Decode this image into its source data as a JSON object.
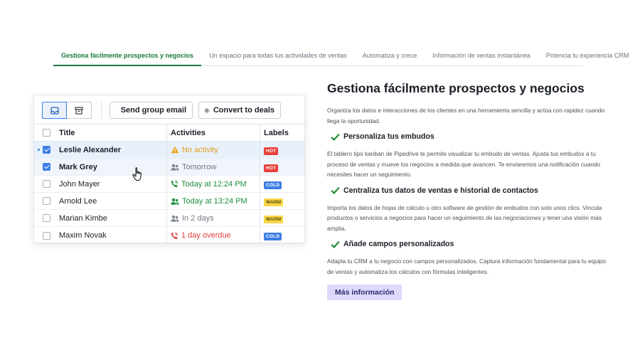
{
  "tabs": [
    {
      "label": "Gestiona fácilmente prospectos y negocios",
      "active": true
    },
    {
      "label": "Un espacio para todas tus actividades de ventas",
      "active": false
    },
    {
      "label": "Automatiza y crece",
      "active": false
    },
    {
      "label": "Información de ventas instantánea",
      "active": false
    },
    {
      "label": "Potencia tu experiencia CRM",
      "active": false
    }
  ],
  "toolbar": {
    "send_email_label": "Send group email",
    "convert_label": "Convert to deals"
  },
  "table": {
    "headers": {
      "title": "Title",
      "activities": "Activities",
      "labels": "Labels"
    },
    "rows": [
      {
        "name": "Leslie Alexander",
        "activity": "No activity",
        "activity_icon": "warning-icon",
        "activity_color": "#e2981a",
        "label": "HOT",
        "label_bg": "#e8403b",
        "label_fg": "#ffffff",
        "checked": true
      },
      {
        "name": "Mark Grey",
        "activity": "Tomorrow",
        "activity_icon": "people-icon",
        "activity_color": "#6f7680",
        "label": "HOT",
        "label_bg": "#e8403b",
        "label_fg": "#ffffff",
        "checked": true
      },
      {
        "name": "John Mayer",
        "activity": "Today at 12:24 PM",
        "activity_icon": "phone-icon",
        "activity_color": "#1e8f3c",
        "label": "COLD",
        "label_bg": "#3d7de5",
        "label_fg": "#ffffff",
        "checked": false
      },
      {
        "name": "Arnold Lee",
        "activity": "Today at 13:24 PM",
        "activity_icon": "people-icon",
        "activity_color": "#1e8f3c",
        "label": "WARM",
        "label_bg": "#f7d64a",
        "label_fg": "#5a4a00",
        "checked": false
      },
      {
        "name": "Marian Kimbe",
        "activity": "In 2 days",
        "activity_icon": "people-icon",
        "activity_color": "#6f7680",
        "label": "WARM",
        "label_bg": "#f7d64a",
        "label_fg": "#5a4a00",
        "checked": false
      },
      {
        "name": "Maxim Novak",
        "activity": "1 day overdue",
        "activity_icon": "phone-icon",
        "activity_color": "#e33b3b",
        "label": "COLD",
        "label_bg": "#3d7de5",
        "label_fg": "#ffffff",
        "checked": false
      }
    ]
  },
  "content": {
    "title": "Gestiona fácilmente prospectos y negocios",
    "intro": "Organiza los datos e interacciones de los clientes en una herramienta sencilla y actúa con rapidez cuando llega la oportunidad.",
    "features": [
      {
        "heading": "Personaliza tus embudos",
        "text": "El tablero tipo kanban de Pipedrive te permite visualizar tu embudo de ventas. Ajusta tus embudos a tu proceso de ventas y mueve los negocios a medida que avancen. Te enviaremos una notificación cuando necesites hacer un seguimiento."
      },
      {
        "heading": "Centraliza tus datos de ventas e historial de contactos",
        "text": "Importa los datos de hojas de cálculo u otro software de gestión de embudos con solo unos clics. Vincula productos o servicios a negocios para hacer un seguimiento de las negociaciones y tener una visión más amplia."
      },
      {
        "heading": "Añade campos personalizados",
        "text": "Adapta tu CRM a tu negocio con campos personalizados. Captura información fundamental para tu equipo de ventas y automatiza los cálculos con fórmulas inteligentes."
      }
    ],
    "cta_label": "Más información"
  },
  "colors": {
    "accent_green": "#187a3c",
    "check_green": "#1e8f3c",
    "selection_blue": "#3d7de5",
    "cta_bg": "#ddd9fb"
  }
}
